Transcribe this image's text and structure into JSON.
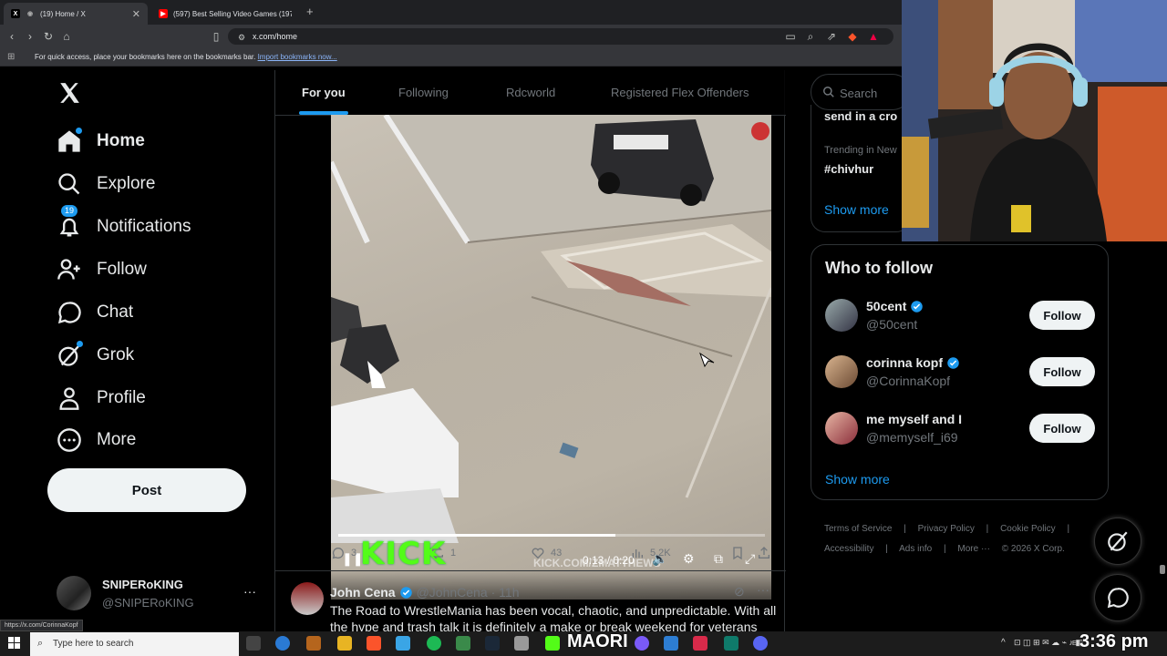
{
  "browser": {
    "tabs": [
      {
        "title": "(19) Home / X",
        "active": true
      },
      {
        "title": "(597) Best Selling Video Games (197",
        "active": false
      }
    ],
    "url": "x.com/home",
    "bookmarks_prompt": "For quick access, place your bookmarks here on the bookmarks bar.",
    "bookmarks_link": "Import bookmarks now...",
    "status_url": "https://x.com/CorinnaKopf"
  },
  "nav": {
    "items": [
      {
        "label": "Home",
        "icon": "home-icon"
      },
      {
        "label": "Explore",
        "icon": "search-icon"
      },
      {
        "label": "Notifications",
        "icon": "bell-icon",
        "badge": "19"
      },
      {
        "label": "Follow",
        "icon": "person-add-icon"
      },
      {
        "label": "Chat",
        "icon": "chat-icon"
      },
      {
        "label": "Grok",
        "icon": "grok-icon"
      },
      {
        "label": "Profile",
        "icon": "profile-icon"
      },
      {
        "label": "More",
        "icon": "more-circle-icon"
      }
    ],
    "post_label": "Post",
    "account": {
      "name": "SNIPERoKING",
      "handle": "@SNIPERoKING",
      "more": "···"
    }
  },
  "feed": {
    "tabs": [
      "For you",
      "Following",
      "Rdcworld",
      "Registered Flex Offenders"
    ],
    "video": {
      "time": "0:13 / 0:20",
      "watermark": "KICK.COM/ZMATTHEWS",
      "logo_text": "KICK",
      "progress": 0.65
    },
    "stats": {
      "replies": "3",
      "reposts": "1",
      "likes": "43",
      "views": "5.2K"
    },
    "next_tweet": {
      "name": "John Cena",
      "handle": "@JohnCena",
      "time": "· 11h",
      "text": "The Road to WrestleMania has been vocal, chaotic, and unpredictable. With all the hype and trash talk it is definitely a make or break weekend for veterans"
    }
  },
  "sidebar": {
    "search_placeholder": "Search",
    "trend_partial": "send in a cro",
    "trend_category": "Trending in New",
    "trend_tag": "#chivhur",
    "show_more": "Show more",
    "who_to_follow_title": "Who to follow",
    "suggestions": [
      {
        "name": "50cent",
        "handle": "@50cent",
        "button": "Follow"
      },
      {
        "name": "corinna kopf",
        "handle": "@CorinnaKopf",
        "button": "Follow"
      },
      {
        "name": "me myself and I",
        "handle": "@memyself_i69",
        "button": "Follow"
      }
    ],
    "wtf_show_more": "Show more",
    "footer": {
      "row1": [
        "Terms of Service",
        "|",
        "Privacy Policy",
        "|",
        "Cookie Policy",
        "|"
      ],
      "row2": [
        "Accessibility",
        "|",
        "Ads info",
        "|",
        "More ···",
        "© 2026 X Corp."
      ]
    }
  },
  "taskbar": {
    "search_placeholder": "Type here to search",
    "clock": "3:36 pm",
    "app_label": "MAORI",
    "lang": "EN"
  },
  "colors": {
    "accent": "#1d9bf0",
    "background": "#000000",
    "kick_green": "#53fc18"
  }
}
